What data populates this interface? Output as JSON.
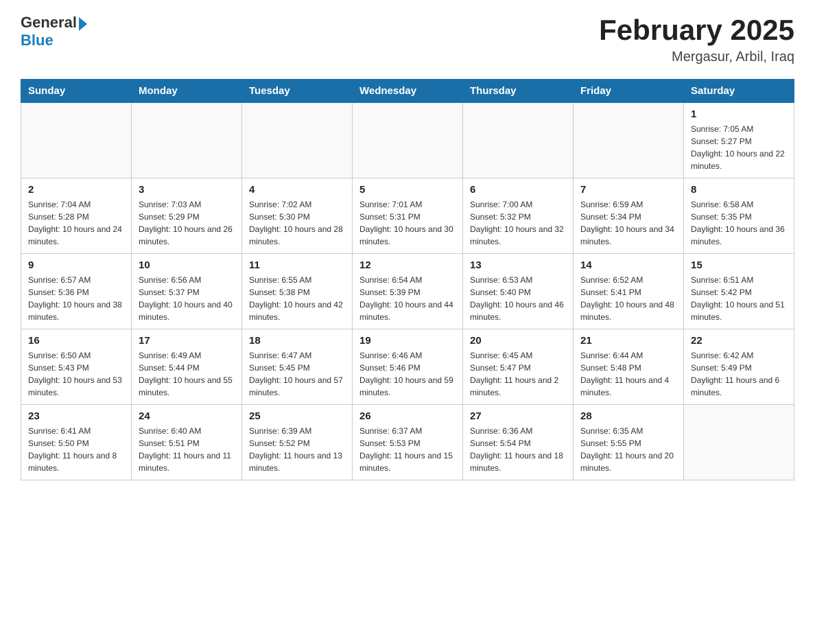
{
  "header": {
    "logo_general": "General",
    "logo_blue": "Blue",
    "title": "February 2025",
    "subtitle": "Mergasur, Arbil, Iraq"
  },
  "days_of_week": [
    "Sunday",
    "Monday",
    "Tuesday",
    "Wednesday",
    "Thursday",
    "Friday",
    "Saturday"
  ],
  "weeks": [
    [
      {
        "day": "",
        "info": ""
      },
      {
        "day": "",
        "info": ""
      },
      {
        "day": "",
        "info": ""
      },
      {
        "day": "",
        "info": ""
      },
      {
        "day": "",
        "info": ""
      },
      {
        "day": "",
        "info": ""
      },
      {
        "day": "1",
        "info": "Sunrise: 7:05 AM\nSunset: 5:27 PM\nDaylight: 10 hours and 22 minutes."
      }
    ],
    [
      {
        "day": "2",
        "info": "Sunrise: 7:04 AM\nSunset: 5:28 PM\nDaylight: 10 hours and 24 minutes."
      },
      {
        "day": "3",
        "info": "Sunrise: 7:03 AM\nSunset: 5:29 PM\nDaylight: 10 hours and 26 minutes."
      },
      {
        "day": "4",
        "info": "Sunrise: 7:02 AM\nSunset: 5:30 PM\nDaylight: 10 hours and 28 minutes."
      },
      {
        "day": "5",
        "info": "Sunrise: 7:01 AM\nSunset: 5:31 PM\nDaylight: 10 hours and 30 minutes."
      },
      {
        "day": "6",
        "info": "Sunrise: 7:00 AM\nSunset: 5:32 PM\nDaylight: 10 hours and 32 minutes."
      },
      {
        "day": "7",
        "info": "Sunrise: 6:59 AM\nSunset: 5:34 PM\nDaylight: 10 hours and 34 minutes."
      },
      {
        "day": "8",
        "info": "Sunrise: 6:58 AM\nSunset: 5:35 PM\nDaylight: 10 hours and 36 minutes."
      }
    ],
    [
      {
        "day": "9",
        "info": "Sunrise: 6:57 AM\nSunset: 5:36 PM\nDaylight: 10 hours and 38 minutes."
      },
      {
        "day": "10",
        "info": "Sunrise: 6:56 AM\nSunset: 5:37 PM\nDaylight: 10 hours and 40 minutes."
      },
      {
        "day": "11",
        "info": "Sunrise: 6:55 AM\nSunset: 5:38 PM\nDaylight: 10 hours and 42 minutes."
      },
      {
        "day": "12",
        "info": "Sunrise: 6:54 AM\nSunset: 5:39 PM\nDaylight: 10 hours and 44 minutes."
      },
      {
        "day": "13",
        "info": "Sunrise: 6:53 AM\nSunset: 5:40 PM\nDaylight: 10 hours and 46 minutes."
      },
      {
        "day": "14",
        "info": "Sunrise: 6:52 AM\nSunset: 5:41 PM\nDaylight: 10 hours and 48 minutes."
      },
      {
        "day": "15",
        "info": "Sunrise: 6:51 AM\nSunset: 5:42 PM\nDaylight: 10 hours and 51 minutes."
      }
    ],
    [
      {
        "day": "16",
        "info": "Sunrise: 6:50 AM\nSunset: 5:43 PM\nDaylight: 10 hours and 53 minutes."
      },
      {
        "day": "17",
        "info": "Sunrise: 6:49 AM\nSunset: 5:44 PM\nDaylight: 10 hours and 55 minutes."
      },
      {
        "day": "18",
        "info": "Sunrise: 6:47 AM\nSunset: 5:45 PM\nDaylight: 10 hours and 57 minutes."
      },
      {
        "day": "19",
        "info": "Sunrise: 6:46 AM\nSunset: 5:46 PM\nDaylight: 10 hours and 59 minutes."
      },
      {
        "day": "20",
        "info": "Sunrise: 6:45 AM\nSunset: 5:47 PM\nDaylight: 11 hours and 2 minutes."
      },
      {
        "day": "21",
        "info": "Sunrise: 6:44 AM\nSunset: 5:48 PM\nDaylight: 11 hours and 4 minutes."
      },
      {
        "day": "22",
        "info": "Sunrise: 6:42 AM\nSunset: 5:49 PM\nDaylight: 11 hours and 6 minutes."
      }
    ],
    [
      {
        "day": "23",
        "info": "Sunrise: 6:41 AM\nSunset: 5:50 PM\nDaylight: 11 hours and 8 minutes."
      },
      {
        "day": "24",
        "info": "Sunrise: 6:40 AM\nSunset: 5:51 PM\nDaylight: 11 hours and 11 minutes."
      },
      {
        "day": "25",
        "info": "Sunrise: 6:39 AM\nSunset: 5:52 PM\nDaylight: 11 hours and 13 minutes."
      },
      {
        "day": "26",
        "info": "Sunrise: 6:37 AM\nSunset: 5:53 PM\nDaylight: 11 hours and 15 minutes."
      },
      {
        "day": "27",
        "info": "Sunrise: 6:36 AM\nSunset: 5:54 PM\nDaylight: 11 hours and 18 minutes."
      },
      {
        "day": "28",
        "info": "Sunrise: 6:35 AM\nSunset: 5:55 PM\nDaylight: 11 hours and 20 minutes."
      },
      {
        "day": "",
        "info": ""
      }
    ]
  ]
}
